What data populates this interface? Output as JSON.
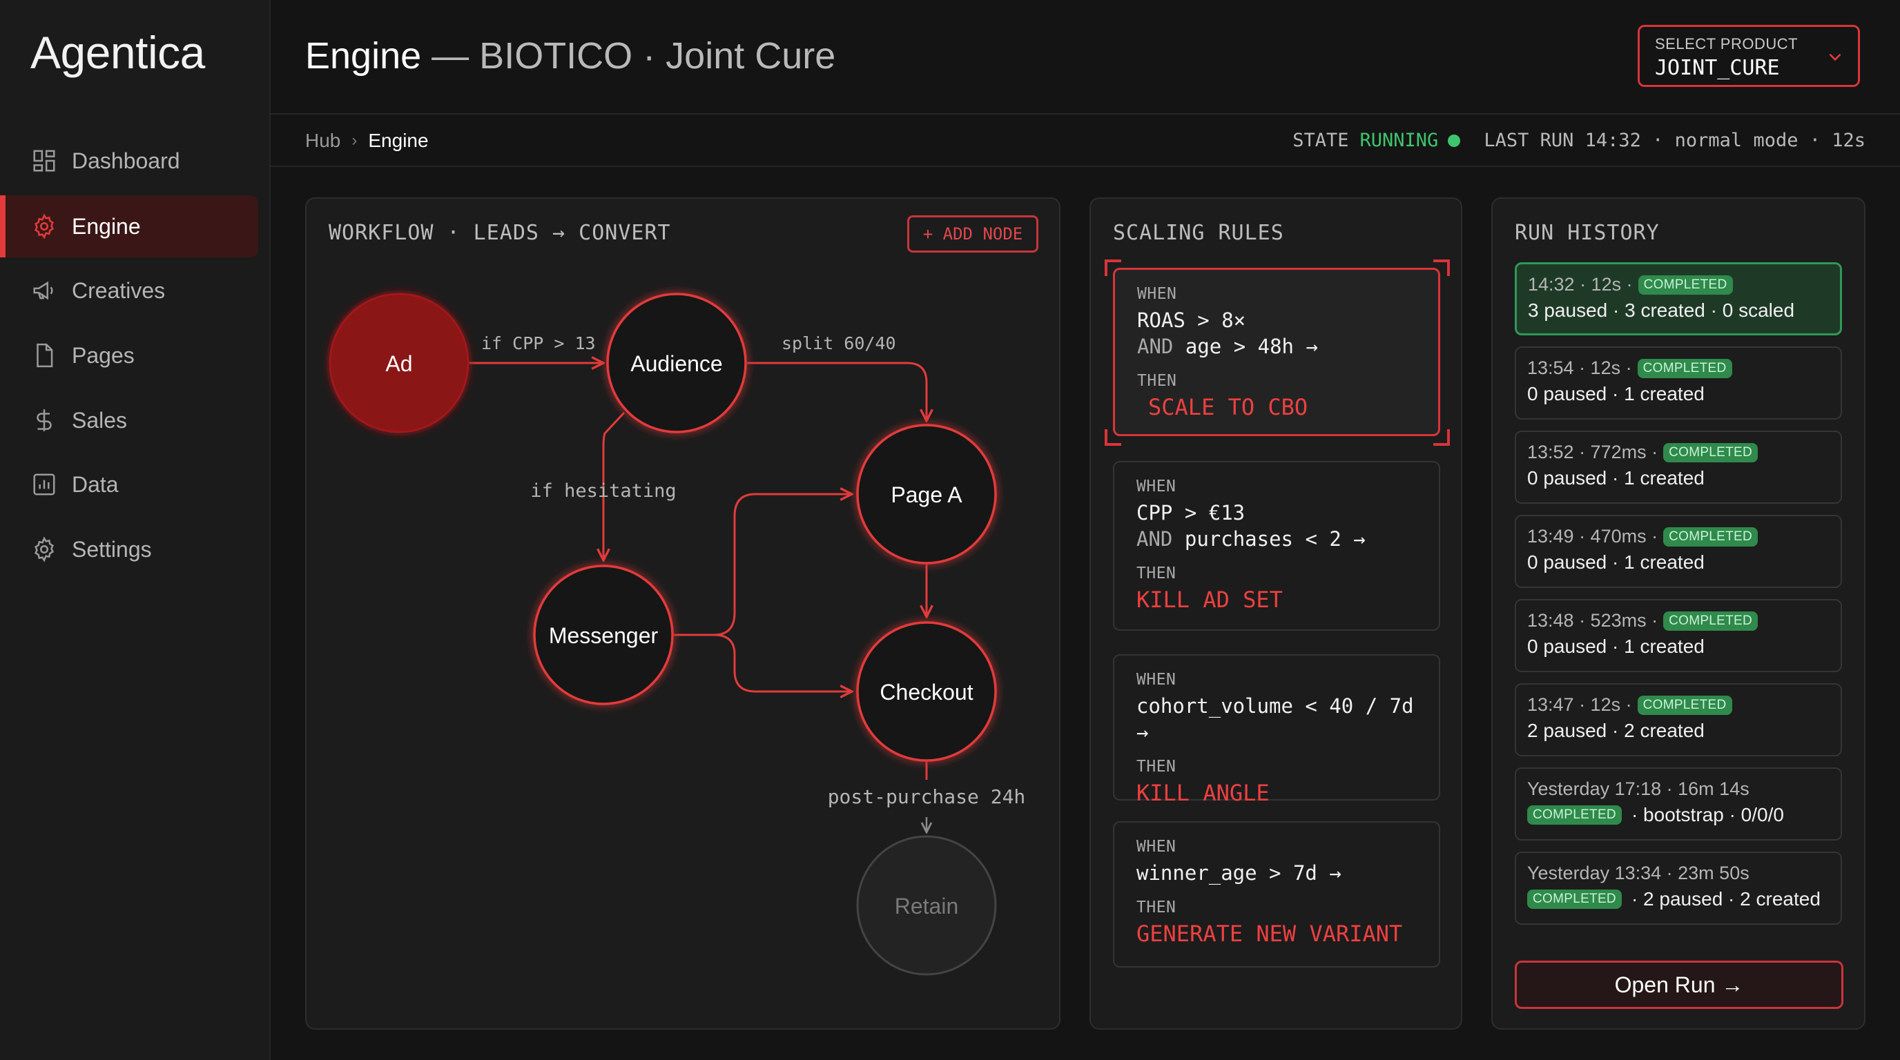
{
  "app": {
    "logo": "Agentica"
  },
  "sidebar": {
    "items": [
      {
        "label": "Dashboard",
        "icon": "dashboard-icon"
      },
      {
        "label": "Engine",
        "icon": "gear-icon",
        "active": true
      },
      {
        "label": "Creatives",
        "icon": "megaphone-icon"
      },
      {
        "label": "Pages",
        "icon": "page-icon"
      },
      {
        "label": "Sales",
        "icon": "dollar-icon"
      },
      {
        "label": "Data",
        "icon": "chart-icon"
      },
      {
        "label": "Settings",
        "icon": "settings-icon"
      }
    ]
  },
  "header": {
    "title": "Engine",
    "subtitle": "— BIOTICO · Joint Cure",
    "product_label": "SELECT PRODUCT",
    "product_value": "JOINT_CURE"
  },
  "breadcrumb": {
    "hub": "Hub",
    "sep": "›",
    "current": "Engine"
  },
  "status": {
    "state_label": "STATE",
    "state_value": "RUNNING",
    "last_run": "LAST RUN 14:32 · normal mode · 12s"
  },
  "workflow": {
    "title": "WORKFLOW · LEADS → CONVERT",
    "add_node": "+ ADD NODE",
    "nodes": {
      "ad": "Ad",
      "audience": "Audience",
      "page_a": "Page A",
      "messenger": "Messenger",
      "checkout": "Checkout",
      "retain": "Retain"
    },
    "edges": {
      "ad_audience": "if CPP > 13",
      "audience_page": "split 60/40",
      "audience_messenger": "if hesitating",
      "checkout_retain": "post-purchase 24h"
    }
  },
  "scaling": {
    "title": "SCALING RULES",
    "when_label": "WHEN",
    "then_label": "THEN",
    "rules": [
      {
        "line1": "ROAS > 8×",
        "and": "AND",
        "line2": "age > 48h →",
        "action": "SCALE TO CBO"
      },
      {
        "line1": "CPP > €13",
        "and": "AND",
        "line2": "purchases < 2 →",
        "action": "KILL AD SET"
      },
      {
        "line1": "cohort_volume < 40 / 7d →",
        "action": "KILL ANGLE"
      },
      {
        "line1": "winner_age > 7d →",
        "action": "GENERATE NEW VARIANT"
      }
    ]
  },
  "history": {
    "title": "RUN HISTORY",
    "badge": "COMPLETED",
    "runs": [
      {
        "meta": "14:32 · 12s ·",
        "summary": "3 paused · 3 created · 0 scaled"
      },
      {
        "meta": "13:54 · 12s ·",
        "summary": "0 paused · 1 created"
      },
      {
        "meta": "13:52 · 772ms ·",
        "summary": "0 paused · 1 created"
      },
      {
        "meta": "13:49 · 470ms ·",
        "summary": "0 paused · 1 created"
      },
      {
        "meta": "13:48 · 523ms ·",
        "summary": "0 paused · 1 created"
      },
      {
        "meta": "13:47 · 12s ·",
        "summary": "2 paused · 2 created"
      },
      {
        "meta": "Yesterday 17:18 · 16m 14s",
        "summary": "· bootstrap · 0/0/0"
      },
      {
        "meta": "Yesterday 13:34 · 23m 50s",
        "summary": "· 2 paused · 2 created"
      }
    ],
    "open_run": "Open Run →"
  },
  "colors": {
    "accent": "#e23b3b",
    "success": "#3ec46d",
    "background": "#141414"
  }
}
